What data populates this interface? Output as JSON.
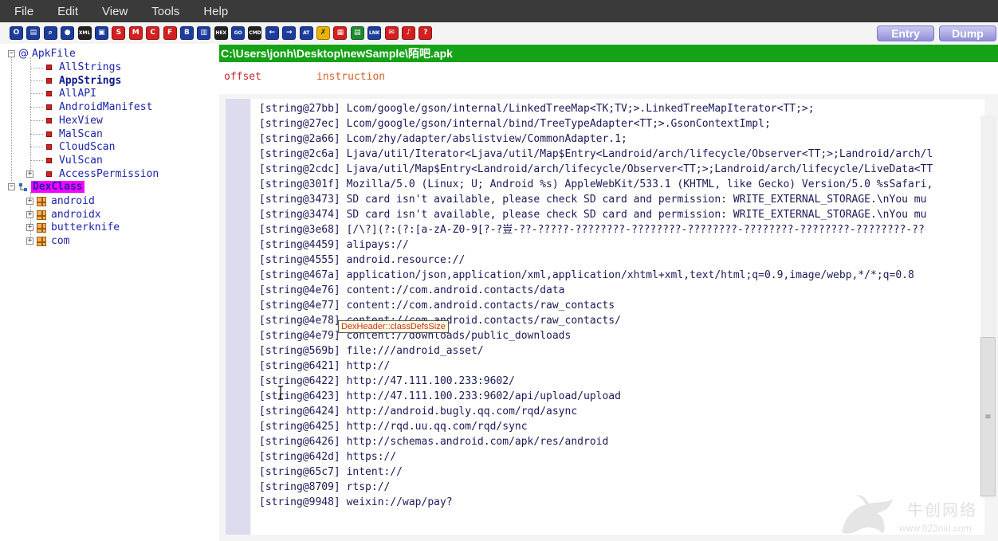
{
  "menu": [
    "File",
    "Edit",
    "View",
    "Tools",
    "Help"
  ],
  "toolbar": {
    "buttons": [
      {
        "label": "O",
        "color": "blue"
      },
      {
        "label": "▤",
        "color": "blue"
      },
      {
        "label": "⌕",
        "color": "blue"
      },
      {
        "label": "●",
        "color": "blue"
      },
      {
        "label": "XML",
        "color": "dark",
        "tiny": true
      },
      {
        "label": "▣",
        "color": "blue"
      },
      {
        "label": "S",
        "color": "red"
      },
      {
        "label": "M",
        "color": "red"
      },
      {
        "label": "C",
        "color": "red"
      },
      {
        "label": "F",
        "color": "red"
      },
      {
        "label": "B",
        "color": "blue"
      },
      {
        "label": "▥",
        "color": "blue"
      },
      {
        "label": "HEX",
        "color": "dark",
        "tiny": true
      },
      {
        "label": "GO",
        "color": "blue",
        "tiny": true
      },
      {
        "label": "CMD",
        "color": "dark",
        "tiny": true
      },
      {
        "label": "←",
        "color": "blue"
      },
      {
        "label": "→",
        "color": "blue"
      },
      {
        "label": "AT",
        "color": "blue",
        "tiny": true
      },
      {
        "label": "✗",
        "color": "yellow"
      },
      {
        "label": "▦",
        "color": "red"
      },
      {
        "label": "▤",
        "color": "green"
      },
      {
        "label": "LNK",
        "color": "blue",
        "tiny": true
      },
      {
        "label": "✉",
        "color": "red"
      },
      {
        "label": "♪",
        "color": "red"
      },
      {
        "label": "?",
        "color": "red"
      }
    ],
    "entry_label": "Entry",
    "dump_label": "Dump"
  },
  "tree": {
    "root": "ApkFile",
    "children": [
      "AllStrings",
      "AppStrings",
      "AllAPI",
      "AndroidManifest",
      "HexView",
      "MalScan",
      "CloudScan",
      "VulScan",
      "AccessPermission"
    ],
    "selected": "AppStrings",
    "dex_root": "DexClass",
    "packages": [
      "android",
      "androidx",
      "butterknife",
      "com"
    ]
  },
  "path": "C:\\Users\\jonh\\Desktop\\newSample\\陌吧.apk",
  "columns": {
    "offset": "offset",
    "instruction": "instruction"
  },
  "lines": [
    "[string@27bb] Lcom/google/gson/internal/LinkedTreeMap<TK;TV;>.LinkedTreeMapIterator<TT;>;",
    "[string@27ec] Lcom/google/gson/internal/bind/TreeTypeAdapter<TT;>.GsonContextImpl;",
    "[string@2a66] Lcom/zhy/adapter/abslistview/CommonAdapter.1;",
    "[string@2c6a] Ljava/util/Iterator<Ljava/util/Map$Entry<Landroid/arch/lifecycle/Observer<TT;>;Landroid/arch/l",
    "[string@2cdc] Ljava/util/Map$Entry<Landroid/arch/lifecycle/Observer<TT;>;Landroid/arch/lifecycle/LiveData<TT",
    "[string@301f] Mozilla/5.0 (Linux; U; Android %s) AppleWebKit/533.1 (KHTML, like Gecko) Version/5.0 %sSafari,",
    "[string@3473] SD card isn't available, please check SD card and permission: WRITE_EXTERNAL_STORAGE.\\nYou mu",
    "[string@3474] SD card isn't available, please check SD card and permission: WRITE_EXTERNAL_STORAGE.\\nYou mu",
    "[string@3e68] [/\\?](?:(?:[a-zA-Z0-9[?-?豈-??-?????-????????-????????-????????-????????-????????-????????-??",
    "[string@4459] alipays://",
    "[string@4555] android.resource://",
    "[string@467a] application/json,application/xml,application/xhtml+xml,text/html;q=0.9,image/webp,*/*;q=0.8",
    "[string@4e76] content://com.android.contacts/data",
    "[string@4e77] content://com.android.contacts/raw_contacts",
    "[string@4e78] content://com.android.contacts/raw_contacts/",
    "[string@4e79] content://downloads/public_downloads",
    "[string@569b] file:///android_asset/",
    "[string@6421] http://",
    "[string@6422] http://47.111.100.233:9602/",
    "[string@6423] http://47.111.100.233:9602/api/upload/upload",
    "[string@6424] http://android.bugly.qq.com/rqd/async",
    "[string@6425] http://rqd.uu.qq.com/rqd/sync",
    "[string@6426] http://schemas.android.com/apk/res/android",
    "[string@642d] https://",
    "[string@65c7] intent://",
    "[string@8709] rtsp://",
    "[string@9948] weixin://wap/pay?"
  ],
  "tooltip": "DexHeader::classDefsSize",
  "watermark": {
    "brand": "牛创网络",
    "url": "www.023niu.com"
  },
  "colors": {
    "menubar": "#3a3a3a",
    "path_bar": "#16a216",
    "tree_text": "#1a24a8",
    "dex_highlight": "#ff00ff",
    "gutter": "#dcdcee"
  }
}
